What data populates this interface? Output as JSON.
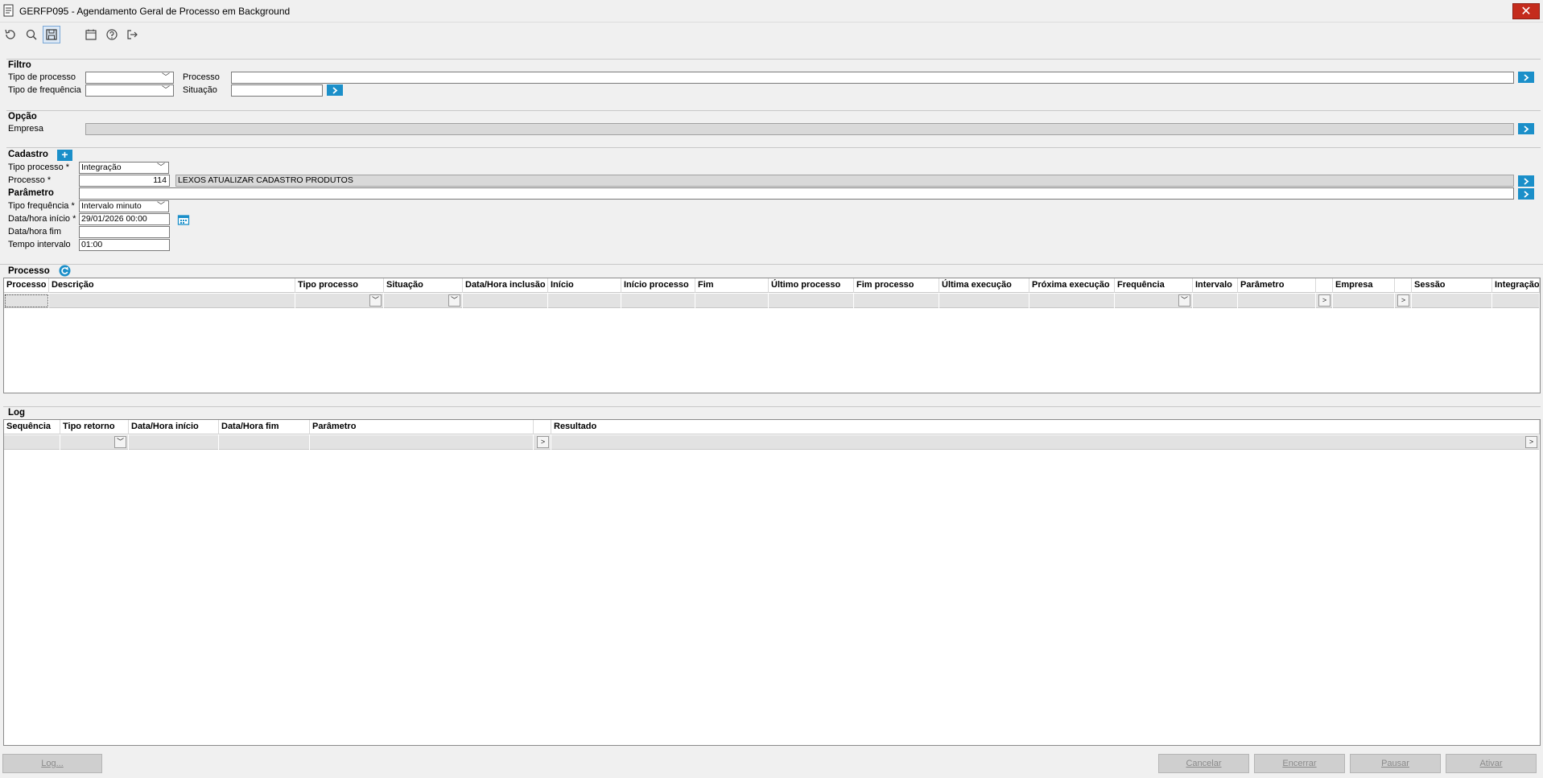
{
  "window": {
    "title": "GERFP095 - Agendamento Geral de Processo em Background",
    "close": "✕"
  },
  "toolbar": {
    "items": [
      {
        "icon": "undo-icon"
      },
      {
        "icon": "search-icon"
      },
      {
        "icon": "save-icon"
      },
      {
        "icon": "calendar-icon"
      },
      {
        "icon": "help-icon"
      },
      {
        "icon": "exit-icon"
      }
    ]
  },
  "filtro": {
    "title": "Filtro",
    "tipo_processo_label": "Tipo de processo",
    "tipo_frequencia_label": "Tipo de frequência",
    "processo_label": "Processo",
    "situacao_label": "Situação",
    "tipo_processo_value": "",
    "tipo_frequencia_value": "",
    "processo_value": "",
    "situacao_value": ""
  },
  "opcao": {
    "title": "Opção",
    "empresa_label": "Empresa",
    "empresa_value": ""
  },
  "cadastro": {
    "title": "Cadastro",
    "add": "+",
    "tipo_processo_label": "Tipo processo *",
    "tipo_processo_value": "Integração",
    "processo_label": "Processo *",
    "processo_code": "114",
    "processo_desc": "LEXOS ATUALIZAR CADASTRO PRODUTOS",
    "parametro_label": "Parâmetro",
    "parametro_value": "",
    "tipo_frequencia_label": "Tipo frequência *",
    "tipo_frequencia_value": "Intervalo minuto",
    "data_inicio_label": "Data/hora início *",
    "data_inicio_value": "29/01/2026 00:00",
    "data_fim_label": "Data/hora fim",
    "data_fim_value": "",
    "tempo_intervalo_label": "Tempo intervalo",
    "tempo_intervalo_value": "01:00"
  },
  "processo_grid": {
    "title": "Processo",
    "columns": [
      "Processo",
      "Descrição",
      "Tipo processo",
      "Situação",
      "Data/Hora inclusão",
      "Início",
      "Início processo",
      "Fim",
      "Último processo",
      "Fim processo",
      "Última execução",
      "Próxima execução",
      "Frequência",
      "Intervalo",
      "Parâmetro",
      "",
      "Empresa",
      "",
      "Sessão",
      "Integração"
    ]
  },
  "log_grid": {
    "title": "Log",
    "columns": [
      "Sequência",
      "Tipo retorno",
      "Data/Hora início",
      "Data/Hora fim",
      "Parâmetro",
      "",
      "Resultado"
    ]
  },
  "footer": {
    "log_button": "Log...",
    "cancelar": "Cancelar",
    "encerrar": "Encerrar",
    "pausar": "Pausar",
    "ativar": "Ativar"
  },
  "colors": {
    "accent": "#1b8fc9",
    "close": "#c42b1c"
  }
}
